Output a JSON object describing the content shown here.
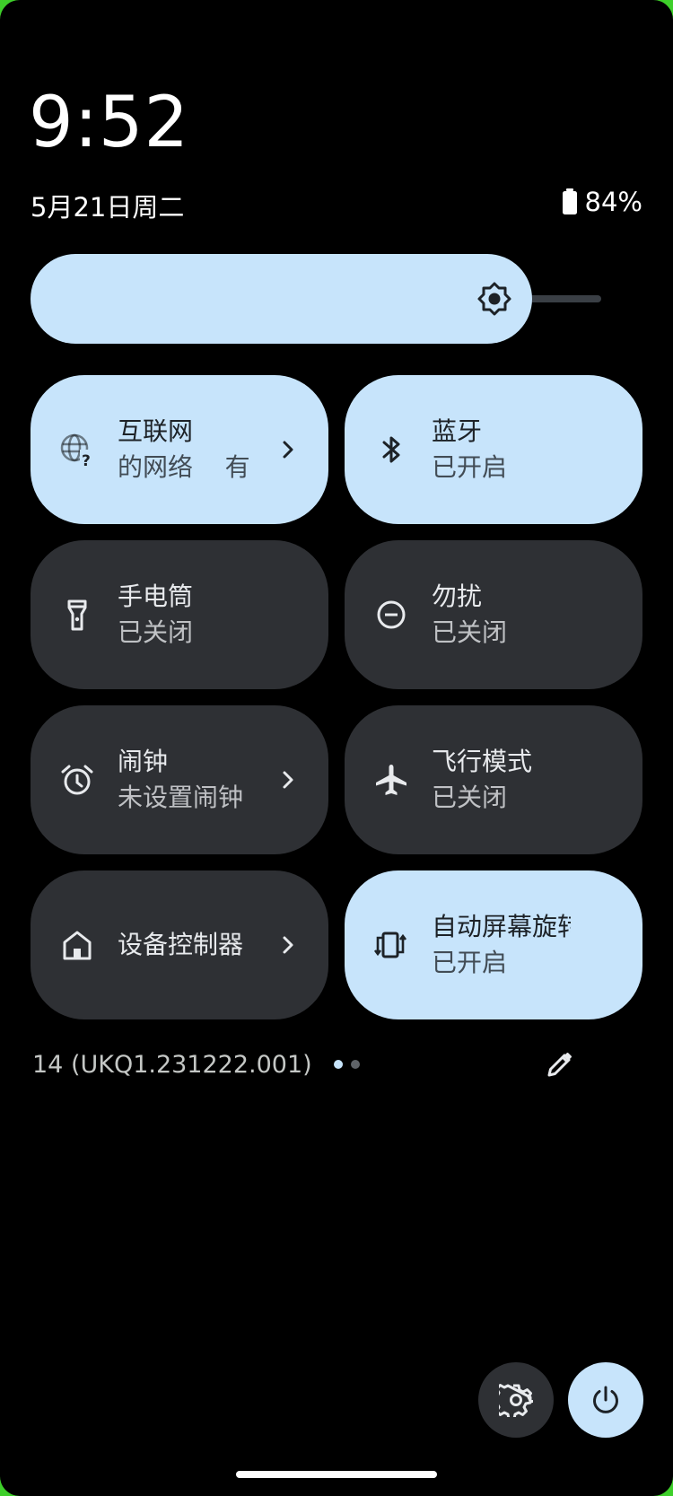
{
  "status": {
    "time": "9:52",
    "date": "5月21日周二",
    "battery_percent": "84%",
    "battery_level": 0.84
  },
  "brightness": {
    "level": 0.91,
    "icon": "brightness-icon"
  },
  "tiles": [
    {
      "title": "互联网",
      "subtitle": "的网络    有",
      "state": "on",
      "icon": "globe-question-icon",
      "chevron": true
    },
    {
      "title": "蓝牙",
      "subtitle": "已开启",
      "state": "on",
      "icon": "bluetooth-icon",
      "chevron": false
    },
    {
      "title": "手电筒",
      "subtitle": "已关闭",
      "state": "off",
      "icon": "flashlight-icon",
      "chevron": false
    },
    {
      "title": "勿扰",
      "subtitle": "已关闭",
      "state": "off",
      "icon": "do-not-disturb-icon",
      "chevron": false
    },
    {
      "title": "闹钟",
      "subtitle": "未设置闹钟",
      "state": "off",
      "icon": "alarm-icon",
      "chevron": true
    },
    {
      "title": "飞行模式",
      "subtitle": "已关闭",
      "state": "off",
      "icon": "airplane-icon",
      "chevron": false
    },
    {
      "title": "设备控制器",
      "subtitle": "",
      "state": "off",
      "icon": "home-icon",
      "chevron": true
    },
    {
      "title": "自动屏幕旋转",
      "subtitle": "已开启",
      "state": "on",
      "icon": "auto-rotate-icon",
      "chevron": false
    }
  ],
  "footer": {
    "build_number": "14 (UKQ1.231222.001)",
    "page_count": 2,
    "current_page": 1
  },
  "colors": {
    "tile_on": "#c7e4fb",
    "tile_off": "#2e3034",
    "background": "#000000"
  }
}
